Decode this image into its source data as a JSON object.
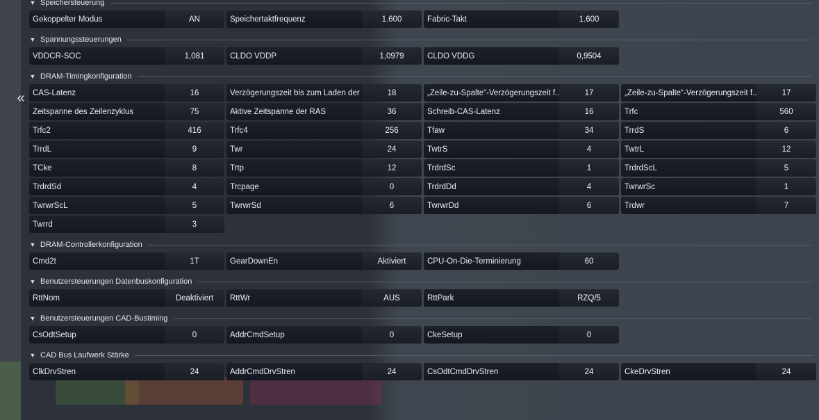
{
  "nav": {
    "collapse_icon": "«"
  },
  "sections": [
    {
      "title": "Speichersteuerung",
      "rows": [
        [
          [
            "Gekoppelter Modus",
            "AN"
          ],
          [
            "Speichertaktfrequenz",
            "1.600"
          ],
          [
            "Fabric-Takt",
            "1.600"
          ]
        ]
      ]
    },
    {
      "title": "Spannungssteuerungen",
      "rows": [
        [
          [
            "VDDCR-SOC",
            "1,081"
          ],
          [
            "CLDO VDDP",
            "1,0979"
          ],
          [
            "CLDO VDDG",
            "0,9504"
          ]
        ]
      ]
    },
    {
      "title": "DRAM-Timingkonfiguration",
      "rows": [
        [
          [
            "CAS-Latenz",
            "16"
          ],
          [
            "Verzögerungszeit bis zum Laden der ...",
            "18"
          ],
          [
            "„Zeile-zu-Spalte“-Verzögerungszeit f...",
            "17"
          ],
          [
            "„Zeile-zu-Spalte“-Verzögerungszeit f...",
            "17"
          ]
        ],
        [
          [
            "Zeitspanne des Zeilenzyklus",
            "75"
          ],
          [
            "Aktive Zeitspanne der RAS",
            "36"
          ],
          [
            "Schreib-CAS-Latenz",
            "16"
          ],
          [
            "Trfc",
            "560"
          ]
        ],
        [
          [
            "Trfc2",
            "416"
          ],
          [
            "Trfc4",
            "256"
          ],
          [
            "Tfaw",
            "34"
          ],
          [
            "TrrdS",
            "6"
          ]
        ],
        [
          [
            "TrrdL",
            "9"
          ],
          [
            "Twr",
            "24"
          ],
          [
            "TwtrS",
            "4"
          ],
          [
            "TwtrL",
            "12"
          ]
        ],
        [
          [
            "TCke",
            "8"
          ],
          [
            "Trtp",
            "12"
          ],
          [
            "TrdrdSc",
            "1"
          ],
          [
            "TrdrdScL",
            "5"
          ]
        ],
        [
          [
            "TrdrdSd",
            "4"
          ],
          [
            "Trcpage",
            "0"
          ],
          [
            "TrdrdDd",
            "4"
          ],
          [
            "TwrwrSc",
            "1"
          ]
        ],
        [
          [
            "TwrwrScL",
            "5"
          ],
          [
            "TwrwrSd",
            "6"
          ],
          [
            "TwrwrDd",
            "6"
          ],
          [
            "Trdwr",
            "7"
          ]
        ],
        [
          [
            "Twrrd",
            "3"
          ]
        ]
      ]
    },
    {
      "title": "DRAM-Controllerkonfiguration",
      "rows": [
        [
          [
            "Cmd2t",
            "1T"
          ],
          [
            "GearDownEn",
            "Aktiviert"
          ],
          [
            "CPU-On-Die-Terminierung",
            "60"
          ]
        ]
      ]
    },
    {
      "title": "Benutzersteuerungen Datenbuskonfiguration",
      "rows": [
        [
          [
            "RttNom",
            "Deaktiviert"
          ],
          [
            "RttWr",
            "AUS"
          ],
          [
            "RttPark",
            "RZQ/5"
          ]
        ]
      ]
    },
    {
      "title": "Benutzersteuerungen CAD-Bustiming",
      "rows": [
        [
          [
            "CsOdtSetup",
            "0"
          ],
          [
            "AddrCmdSetup",
            "0"
          ],
          [
            "CkeSetup",
            "0"
          ]
        ]
      ]
    },
    {
      "title": "CAD Bus Laufwerk Stärke",
      "rows": [
        [
          [
            "ClkDrvStren",
            "24"
          ],
          [
            "AddrCmdDrvStren",
            "24"
          ],
          [
            "CsOdtCmdDrvStren",
            "24"
          ],
          [
            "CkeDrvStren",
            "24"
          ]
        ]
      ]
    }
  ],
  "colors": {
    "label_bg": "#181c24",
    "value_bg": "#20252e",
    "panel_bg": "#2d323a",
    "text": "#e9edf2",
    "section_line": "#59606b"
  }
}
